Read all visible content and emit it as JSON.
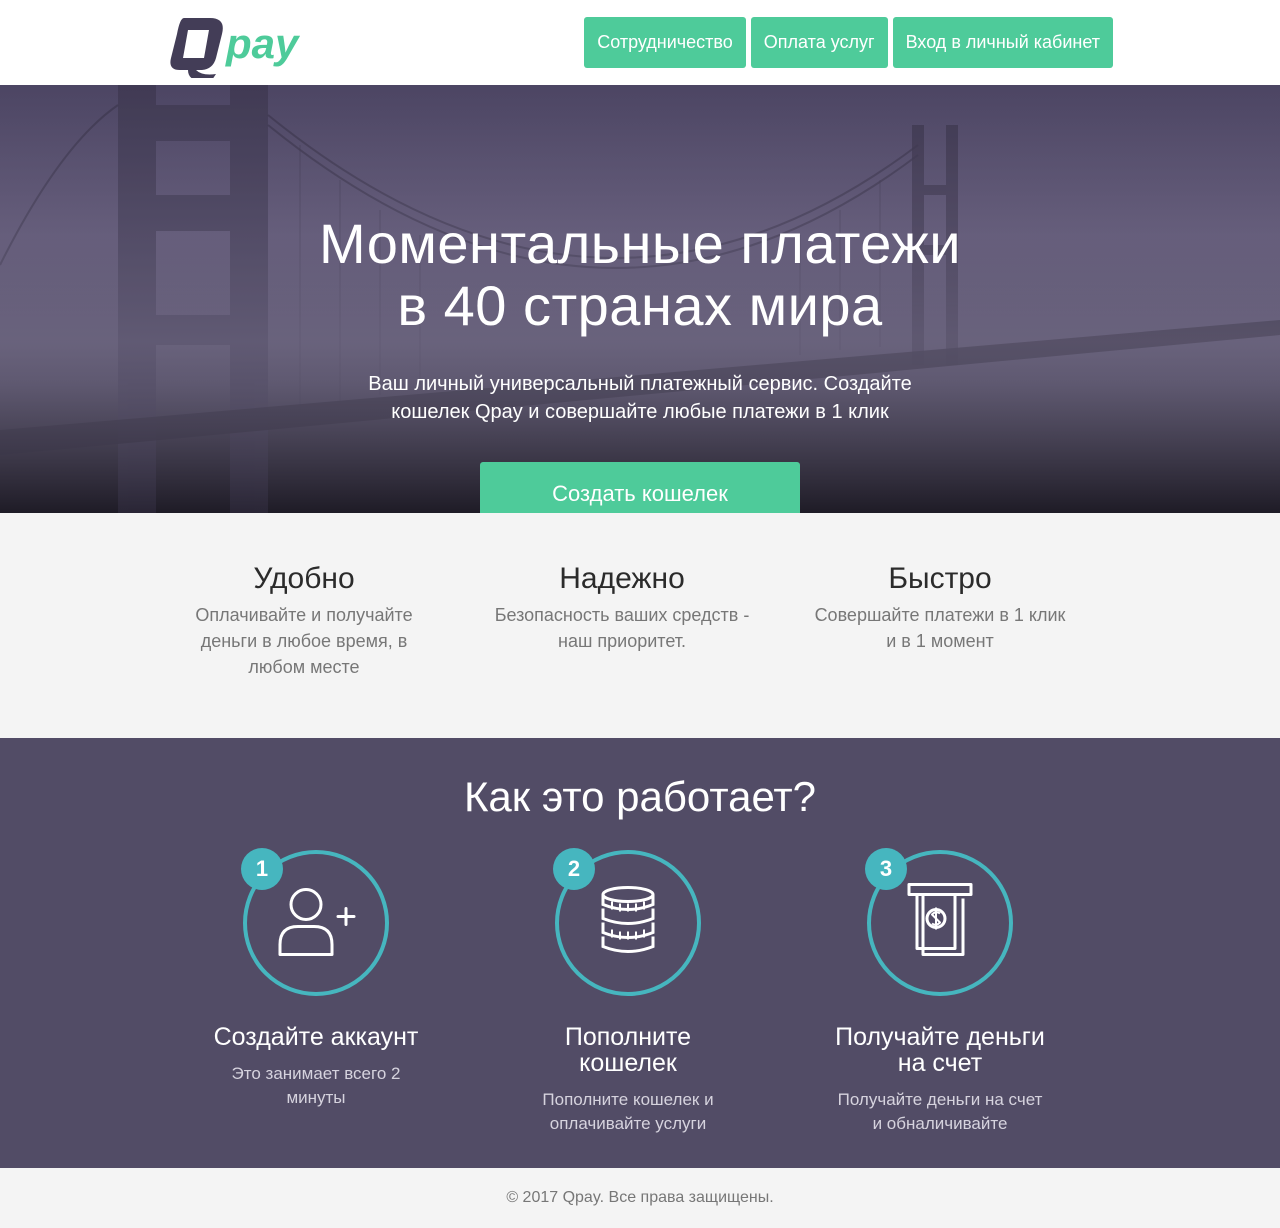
{
  "header": {
    "logo_text": "Qpay",
    "nav": [
      {
        "label": "Сотрудничество"
      },
      {
        "label": "Оплата услуг"
      },
      {
        "label": "Вход в личный кабинет"
      }
    ]
  },
  "hero": {
    "title_line1": "Моментальные платежи",
    "title_line2": "в 40 странах мира",
    "subtitle_line1": "Ваш личный универсальный платежный сервис. Создайте",
    "subtitle_line2": "кошелек Qpay и совершайте любые платежи в 1 клик",
    "cta_label": "Создать кошелек"
  },
  "features": [
    {
      "title": "Удобно",
      "lines": [
        "Оплачивайте и получайте",
        "деньги в любое время, в",
        "любом месте"
      ]
    },
    {
      "title": "Надежно",
      "lines": [
        "Безопасность ваших средств -",
        "наш приоритет."
      ]
    },
    {
      "title": "Быстро",
      "lines": [
        "Совершайте платежи в 1 клик",
        "и в 1 момент"
      ]
    }
  ],
  "how": {
    "title": "Как это работает?",
    "steps": [
      {
        "number": "1",
        "icon": "add-user-icon",
        "title_lines": [
          "Создайте аккаунт"
        ],
        "text_lines": [
          "Это занимает всего 2",
          "минуты"
        ]
      },
      {
        "number": "2",
        "icon": "coins-icon",
        "title_lines": [
          "Пополните",
          "кошелек"
        ],
        "text_lines": [
          "Пополните кошелек и",
          "оплачивайте услуги"
        ]
      },
      {
        "number": "3",
        "icon": "cash-withdraw-icon",
        "title_lines": [
          "Получайте деньги",
          "на счет"
        ],
        "text_lines": [
          "Получайте деньги на счет",
          "и обналичивайте"
        ]
      }
    ]
  },
  "footer": {
    "copyright": "© 2017 Qpay. Все права защищены."
  },
  "colors": {
    "accent": "#4ecb9a",
    "brand_dark": "#433d57",
    "section_purple": "#524c66",
    "ring_teal": "#46b6bf"
  }
}
